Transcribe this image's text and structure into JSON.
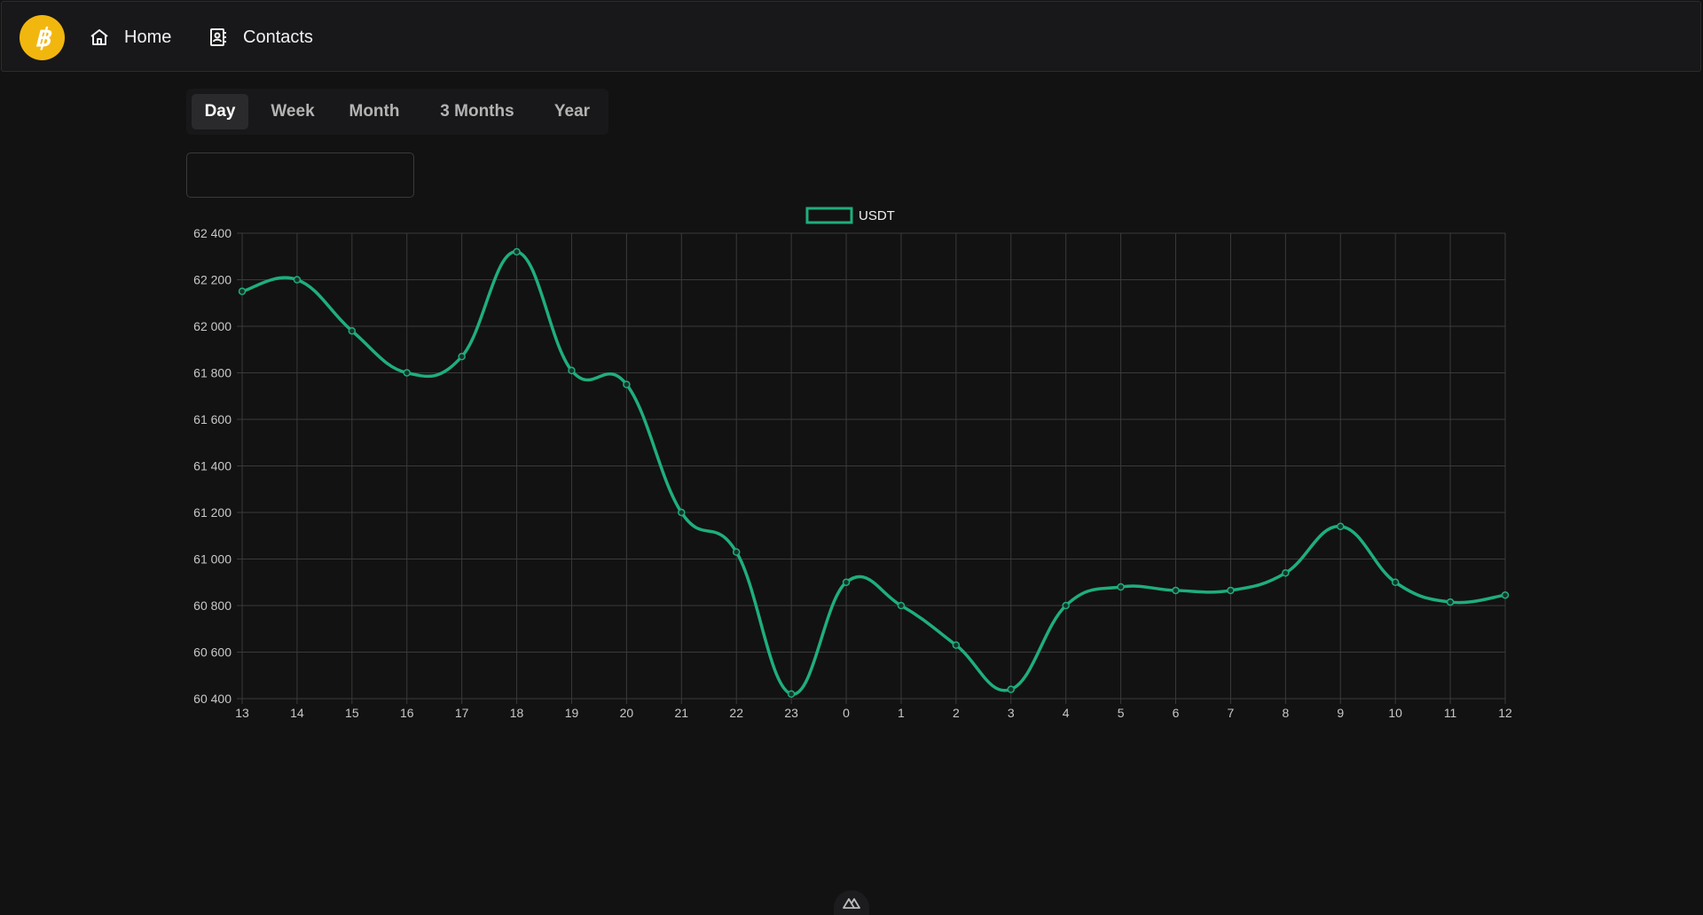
{
  "nav": {
    "items": [
      {
        "label": "Home",
        "icon": "home-icon"
      },
      {
        "label": "Contacts",
        "icon": "contacts-icon"
      }
    ]
  },
  "tabs": [
    {
      "label": "Day",
      "active": true
    },
    {
      "label": "Week",
      "active": false
    },
    {
      "label": "Month",
      "active": false
    },
    {
      "label": "3 Months",
      "active": false
    },
    {
      "label": "Year",
      "active": false
    }
  ],
  "colors": {
    "line": "#1fae7c",
    "brand": "#f2b70e",
    "grid": "#3a3a3c",
    "tick": "#c8c8c8"
  },
  "chart_data": {
    "type": "line",
    "legend": {
      "label": "USDT",
      "position": "top"
    },
    "categories": [
      "13",
      "14",
      "15",
      "16",
      "17",
      "18",
      "19",
      "20",
      "21",
      "22",
      "23",
      "0",
      "1",
      "2",
      "3",
      "4",
      "5",
      "6",
      "7",
      "8",
      "9",
      "10",
      "11",
      "12"
    ],
    "series": [
      {
        "name": "USDT",
        "values": [
          62150,
          62200,
          61980,
          61800,
          61870,
          62320,
          61810,
          61750,
          61200,
          61030,
          60420,
          60900,
          60800,
          60630,
          60440,
          60800,
          60880,
          60865,
          60865,
          60940,
          61140,
          60900,
          60815,
          60845
        ]
      }
    ],
    "ylim": [
      60400,
      62400
    ],
    "yticks": [
      "62 400",
      "62 200",
      "62 000",
      "61 800",
      "61 600",
      "61 400",
      "61 200",
      "61 000",
      "60 800",
      "60 600",
      "60 400"
    ],
    "grid": true
  }
}
